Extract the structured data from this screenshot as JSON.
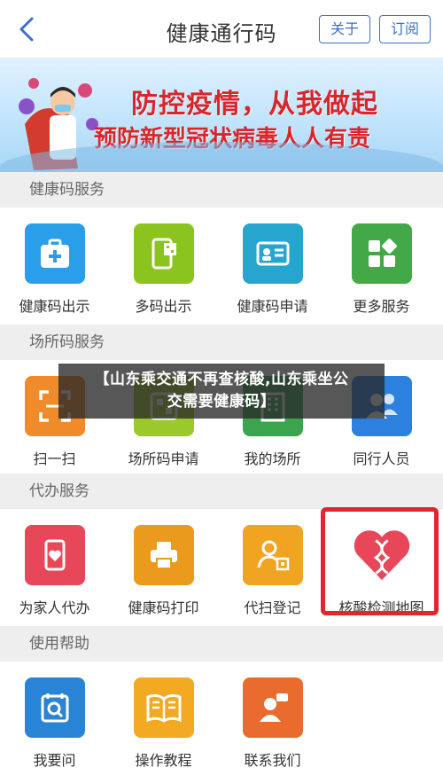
{
  "header": {
    "title": "健康通行码",
    "about_label": "关于",
    "subscribe_label": "订阅"
  },
  "banner": {
    "line1": "防控疫情，从我做起",
    "line2": "预防新型冠状病毒人人有责"
  },
  "sections": [
    {
      "title": "健康码服务",
      "items": [
        {
          "label": "健康码出示",
          "icon": "medical-kit-icon",
          "color": "#2b9ee9"
        },
        {
          "label": "多码出示",
          "icon": "phone-qr-icon",
          "color": "#8bc31f"
        },
        {
          "label": "健康码申请",
          "icon": "id-card-icon",
          "color": "#26a5cf"
        },
        {
          "label": "更多服务",
          "icon": "grid-squares-icon",
          "color": "#43a947"
        }
      ]
    },
    {
      "title": "场所码服务",
      "items": [
        {
          "label": "扫一扫",
          "icon": "scan-icon",
          "color": "#ef8b2a"
        },
        {
          "label": "场所码申请",
          "icon": "place-code-icon",
          "color": "#9bc92c"
        },
        {
          "label": "我的场所",
          "icon": "building-icon",
          "color": "#3aa54d"
        },
        {
          "label": "同行人员",
          "icon": "people-icon",
          "color": "#2b80e0"
        }
      ]
    },
    {
      "title": "代办服务",
      "items": [
        {
          "label": "为家人代办",
          "icon": "phone-heart-icon",
          "color": "#e8475a"
        },
        {
          "label": "健康码打印",
          "icon": "printer-icon",
          "color": "#ea9a1c"
        },
        {
          "label": "代扫登记",
          "icon": "person-qr-icon",
          "color": "#f1a421"
        },
        {
          "label": "核酸检测地图",
          "icon": "dna-heart-icon",
          "color": "#e8475a"
        }
      ]
    },
    {
      "title": "使用帮助",
      "items": [
        {
          "label": "我要问",
          "icon": "question-calendar-icon",
          "color": "#2a84d6"
        },
        {
          "label": "操作教程",
          "icon": "book-icon",
          "color": "#f3a921"
        },
        {
          "label": "联系我们",
          "icon": "contact-person-icon",
          "color": "#e96b2d"
        }
      ]
    }
  ],
  "overlay_caption": {
    "line1": "【山东乘交通不再查核酸,山东乘坐公",
    "line2": "交需要健康码】"
  }
}
